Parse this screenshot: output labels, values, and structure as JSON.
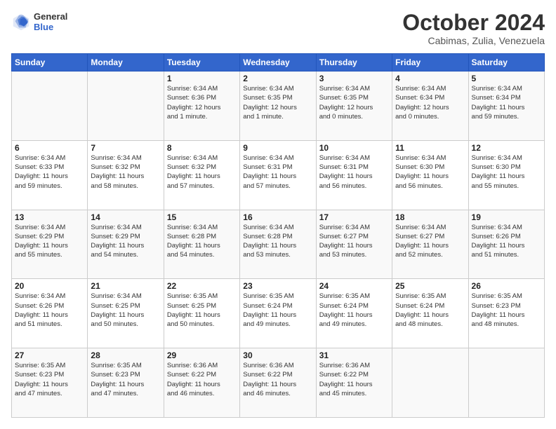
{
  "header": {
    "logo_line1": "General",
    "logo_line2": "Blue",
    "month": "October 2024",
    "location": "Cabimas, Zulia, Venezuela"
  },
  "days_of_week": [
    "Sunday",
    "Monday",
    "Tuesday",
    "Wednesday",
    "Thursday",
    "Friday",
    "Saturday"
  ],
  "weeks": [
    [
      {
        "day": "",
        "info": ""
      },
      {
        "day": "",
        "info": ""
      },
      {
        "day": "1",
        "info": "Sunrise: 6:34 AM\nSunset: 6:36 PM\nDaylight: 12 hours\nand 1 minute."
      },
      {
        "day": "2",
        "info": "Sunrise: 6:34 AM\nSunset: 6:35 PM\nDaylight: 12 hours\nand 1 minute."
      },
      {
        "day": "3",
        "info": "Sunrise: 6:34 AM\nSunset: 6:35 PM\nDaylight: 12 hours\nand 0 minutes."
      },
      {
        "day": "4",
        "info": "Sunrise: 6:34 AM\nSunset: 6:34 PM\nDaylight: 12 hours\nand 0 minutes."
      },
      {
        "day": "5",
        "info": "Sunrise: 6:34 AM\nSunset: 6:34 PM\nDaylight: 11 hours\nand 59 minutes."
      }
    ],
    [
      {
        "day": "6",
        "info": "Sunrise: 6:34 AM\nSunset: 6:33 PM\nDaylight: 11 hours\nand 59 minutes."
      },
      {
        "day": "7",
        "info": "Sunrise: 6:34 AM\nSunset: 6:32 PM\nDaylight: 11 hours\nand 58 minutes."
      },
      {
        "day": "8",
        "info": "Sunrise: 6:34 AM\nSunset: 6:32 PM\nDaylight: 11 hours\nand 57 minutes."
      },
      {
        "day": "9",
        "info": "Sunrise: 6:34 AM\nSunset: 6:31 PM\nDaylight: 11 hours\nand 57 minutes."
      },
      {
        "day": "10",
        "info": "Sunrise: 6:34 AM\nSunset: 6:31 PM\nDaylight: 11 hours\nand 56 minutes."
      },
      {
        "day": "11",
        "info": "Sunrise: 6:34 AM\nSunset: 6:30 PM\nDaylight: 11 hours\nand 56 minutes."
      },
      {
        "day": "12",
        "info": "Sunrise: 6:34 AM\nSunset: 6:30 PM\nDaylight: 11 hours\nand 55 minutes."
      }
    ],
    [
      {
        "day": "13",
        "info": "Sunrise: 6:34 AM\nSunset: 6:29 PM\nDaylight: 11 hours\nand 55 minutes."
      },
      {
        "day": "14",
        "info": "Sunrise: 6:34 AM\nSunset: 6:29 PM\nDaylight: 11 hours\nand 54 minutes."
      },
      {
        "day": "15",
        "info": "Sunrise: 6:34 AM\nSunset: 6:28 PM\nDaylight: 11 hours\nand 54 minutes."
      },
      {
        "day": "16",
        "info": "Sunrise: 6:34 AM\nSunset: 6:28 PM\nDaylight: 11 hours\nand 53 minutes."
      },
      {
        "day": "17",
        "info": "Sunrise: 6:34 AM\nSunset: 6:27 PM\nDaylight: 11 hours\nand 53 minutes."
      },
      {
        "day": "18",
        "info": "Sunrise: 6:34 AM\nSunset: 6:27 PM\nDaylight: 11 hours\nand 52 minutes."
      },
      {
        "day": "19",
        "info": "Sunrise: 6:34 AM\nSunset: 6:26 PM\nDaylight: 11 hours\nand 51 minutes."
      }
    ],
    [
      {
        "day": "20",
        "info": "Sunrise: 6:34 AM\nSunset: 6:26 PM\nDaylight: 11 hours\nand 51 minutes."
      },
      {
        "day": "21",
        "info": "Sunrise: 6:34 AM\nSunset: 6:25 PM\nDaylight: 11 hours\nand 50 minutes."
      },
      {
        "day": "22",
        "info": "Sunrise: 6:35 AM\nSunset: 6:25 PM\nDaylight: 11 hours\nand 50 minutes."
      },
      {
        "day": "23",
        "info": "Sunrise: 6:35 AM\nSunset: 6:24 PM\nDaylight: 11 hours\nand 49 minutes."
      },
      {
        "day": "24",
        "info": "Sunrise: 6:35 AM\nSunset: 6:24 PM\nDaylight: 11 hours\nand 49 minutes."
      },
      {
        "day": "25",
        "info": "Sunrise: 6:35 AM\nSunset: 6:24 PM\nDaylight: 11 hours\nand 48 minutes."
      },
      {
        "day": "26",
        "info": "Sunrise: 6:35 AM\nSunset: 6:23 PM\nDaylight: 11 hours\nand 48 minutes."
      }
    ],
    [
      {
        "day": "27",
        "info": "Sunrise: 6:35 AM\nSunset: 6:23 PM\nDaylight: 11 hours\nand 47 minutes."
      },
      {
        "day": "28",
        "info": "Sunrise: 6:35 AM\nSunset: 6:23 PM\nDaylight: 11 hours\nand 47 minutes."
      },
      {
        "day": "29",
        "info": "Sunrise: 6:36 AM\nSunset: 6:22 PM\nDaylight: 11 hours\nand 46 minutes."
      },
      {
        "day": "30",
        "info": "Sunrise: 6:36 AM\nSunset: 6:22 PM\nDaylight: 11 hours\nand 46 minutes."
      },
      {
        "day": "31",
        "info": "Sunrise: 6:36 AM\nSunset: 6:22 PM\nDaylight: 11 hours\nand 45 minutes."
      },
      {
        "day": "",
        "info": ""
      },
      {
        "day": "",
        "info": ""
      }
    ]
  ]
}
